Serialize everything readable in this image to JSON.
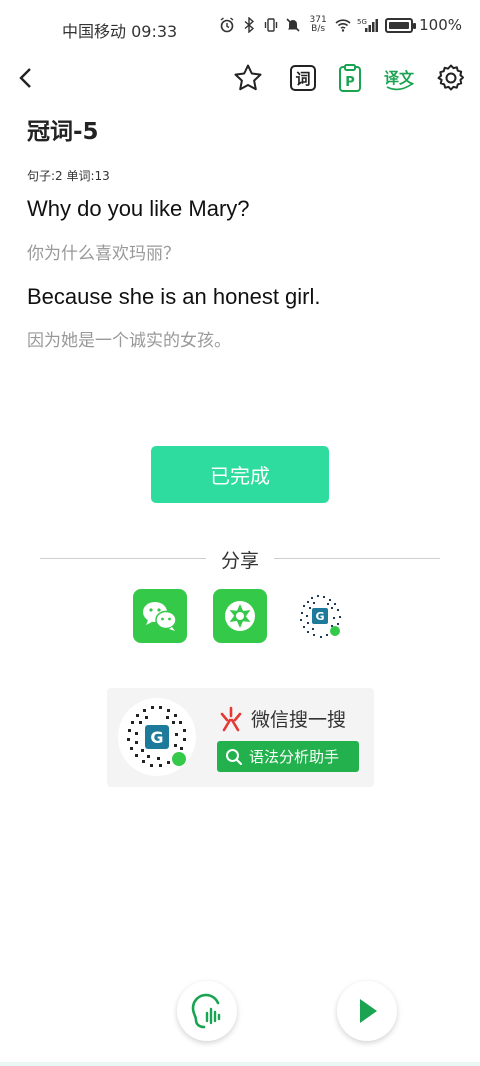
{
  "status_bar": {
    "carrier_time": "中国移动 09:33",
    "speed_value": "371",
    "speed_unit": "B/s",
    "signal_label": "5G",
    "battery": "100%"
  },
  "toolbar": {
    "back_icon": "chevron-left-icon",
    "star_icon": "star-icon",
    "vocab_icon_label": "词",
    "p_icon_label": "P",
    "translate_icon_label": "译文",
    "settings_icon": "gear-icon"
  },
  "lesson": {
    "title": "冠词-5",
    "counts": "句子:2 单词:13",
    "sentences": [
      {
        "en": "Why do you like Mary?",
        "cn": "你为什么喜欢玛丽？"
      },
      {
        "en": "Because she is an honest girl.",
        "cn": "因为她是一个诚实的女孩。"
      }
    ]
  },
  "done_button": "已完成",
  "share": {
    "label": "分享",
    "wechat_icon": "wechat-icon",
    "moments_icon": "moments-icon",
    "qr_icon": "mini-program-qr-icon"
  },
  "mini_program": {
    "search_text": "微信搜一搜",
    "button_text": "语法分析助手"
  },
  "bottom": {
    "listen_icon": "listen-icon",
    "play_icon": "play-icon"
  },
  "colors": {
    "accent": "#2ddc9e",
    "green": "#35c94a",
    "icon_green": "#1aa351",
    "mini_btn": "#22b14c"
  }
}
